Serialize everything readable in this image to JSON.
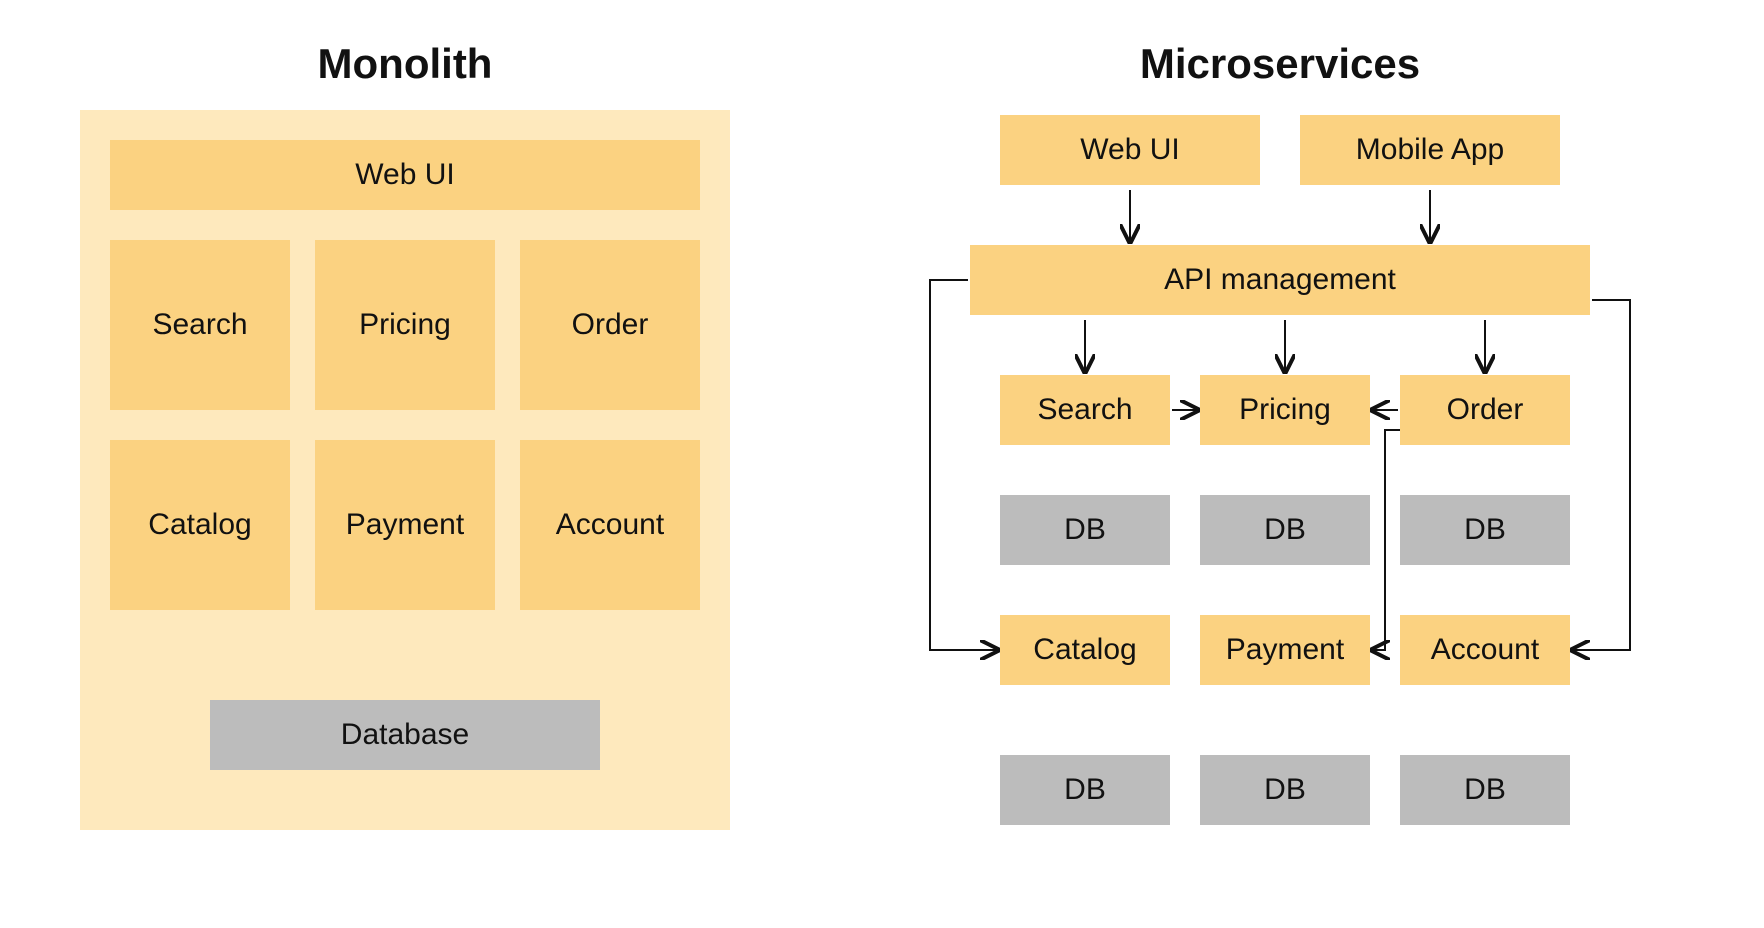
{
  "monolith": {
    "title": "Monolith",
    "webui": "Web UI",
    "modules_row1": [
      "Search",
      "Pricing",
      "Order"
    ],
    "modules_row2": [
      "Catalog",
      "Payment",
      "Account"
    ],
    "database": "Database"
  },
  "microservices": {
    "title": "Microservices",
    "clients": [
      "Web UI",
      "Mobile App"
    ],
    "api": "API management",
    "services_row1": [
      "Search",
      "Pricing",
      "Order"
    ],
    "dbs_row1": [
      "DB",
      "DB",
      "DB"
    ],
    "services_row2": [
      "Catalog",
      "Payment",
      "Account"
    ],
    "dbs_row2": [
      "DB",
      "DB",
      "DB"
    ]
  }
}
